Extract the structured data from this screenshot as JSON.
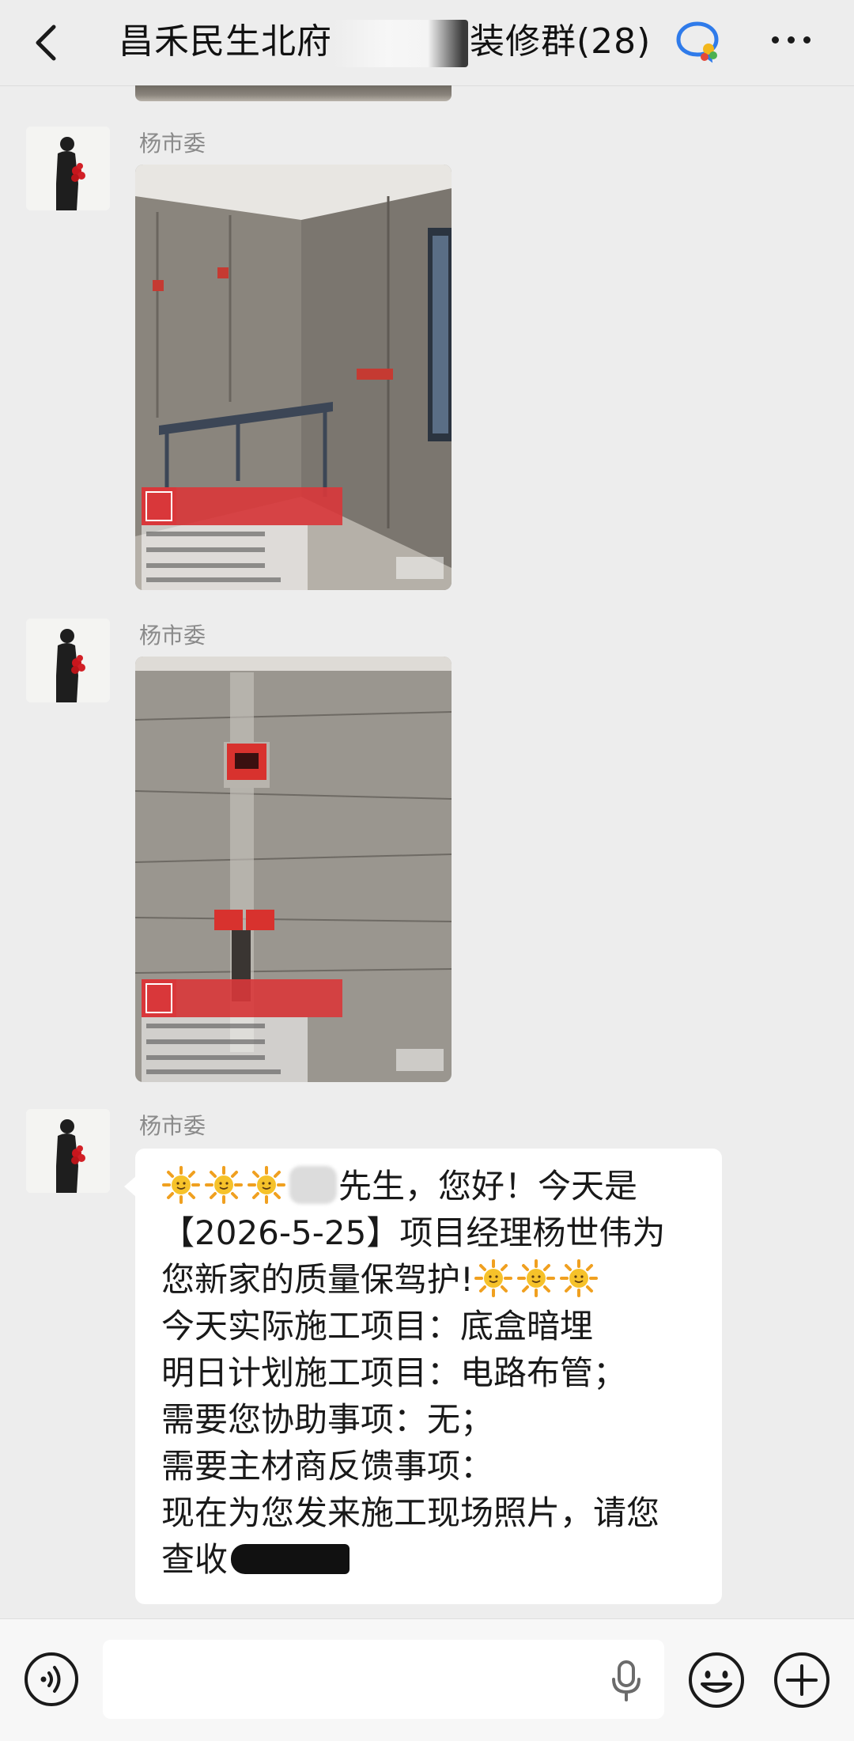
{
  "header": {
    "title_prefix": "昌禾民生北府",
    "title_suffix": "装修群(28)",
    "back_icon": "chevron-left-icon",
    "more_icon": "more-icon",
    "chat_icon": "group-chat-icon"
  },
  "messages": [
    {
      "sender": "杨市委",
      "type": "image"
    },
    {
      "sender": "杨市委",
      "type": "image"
    },
    {
      "sender": "杨市委",
      "type": "text",
      "lines": [
        "先生，您好！今天是",
        "【2026-5-25】项目经理杨世伟为",
        "您新家的质量保驾护!",
        "今天实际施工项目：底盒暗埋",
        "明日计划施工项目：电路布管；",
        "需要您协助事项：无；",
        "需要主材商反馈事项：",
        "现在为您发来施工现场照片，请您",
        "查收"
      ]
    }
  ],
  "input_bar": {
    "placeholder": "",
    "voice_icon": "voice-icon",
    "mic_icon": "microphone-icon",
    "emoji_icon": "emoji-icon",
    "plus_icon": "plus-icon"
  },
  "colors": {
    "background": "#ededed",
    "bubble": "#ffffff",
    "sender_text": "#8a8a8a",
    "watermark_red": "#d9373a"
  }
}
